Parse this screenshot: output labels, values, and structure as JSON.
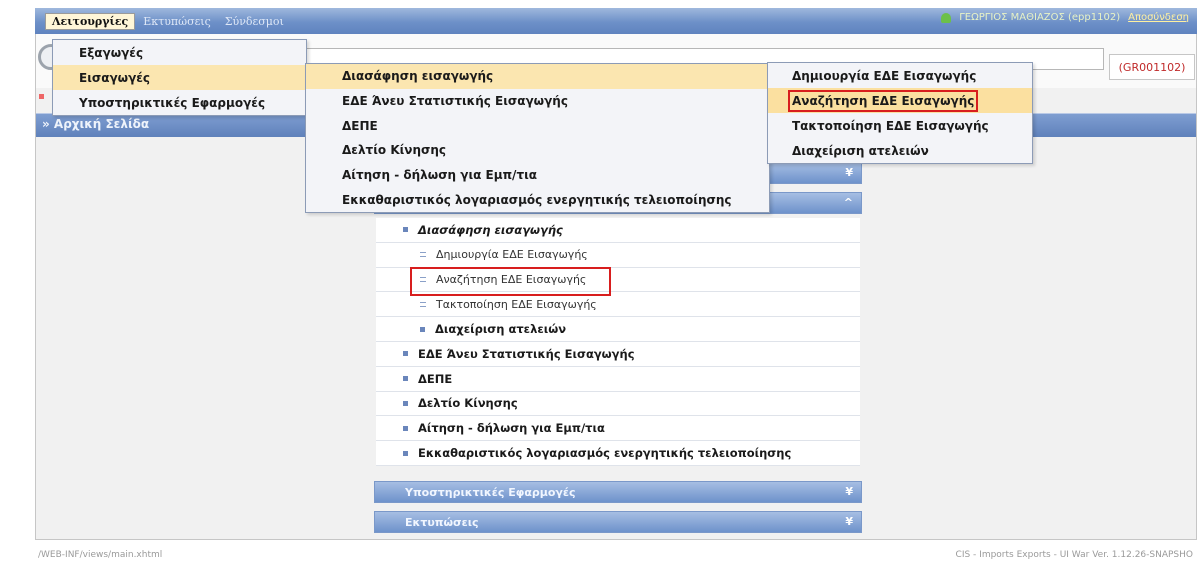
{
  "topmenu": {
    "items": [
      "Λειτουργίες",
      "Εκτυπώσεις",
      "Σύνδεσμοι"
    ]
  },
  "user": {
    "name": "ΓΕΩΡΓΙΟΣ ΜΑΘΙΑΖΟΣ (epp1102)",
    "logout": "Αποσύνδεση"
  },
  "tag": "(GR001102)",
  "home": "» Αρχική Σελίδα",
  "menu1": [
    "Εξαγωγές",
    "Εισαγωγές",
    "Υποστηρικτικές Εφαρμογές"
  ],
  "menu2": [
    "Διασάφηση εισαγωγής",
    "ΕΔΕ Άνευ Στατιστικής Εισαγωγής",
    "ΔΕΠΕ",
    "Δελτίο Κίνησης",
    "Αίτηση - δήλωση για Εμπ/τια",
    "Εκκαθαριστικός λογαριασμός ενεργητικής τελειοποίησης"
  ],
  "menu3": [
    "Δημιουργία ΕΔΕ Εισαγωγής",
    "Αναζήτηση ΕΔΕ Εισαγωγής",
    "Τακτοποίηση ΕΔΕ Εισαγωγής",
    "Διαχείριση ατελειών"
  ],
  "panel": {
    "rows": [
      "Διασάφηση εισαγωγής",
      "Δημιουργία ΕΔΕ Εισαγωγής",
      "Αναζήτηση ΕΔΕ Εισαγωγής",
      "Τακτοποίηση ΕΔΕ Εισαγωγής",
      "Διαχείριση ατελειών",
      "ΕΔΕ Άνευ Στατιστικής Εισαγωγής",
      "ΔΕΠΕ",
      "Δελτίο Κίνησης",
      "Αίτηση - δήλωση για Εμπ/τια",
      "Εκκαθαριστικός λογαριασμός ενεργητικής τελειοποίησης"
    ],
    "section_supp": "Υποστηρικτικές Εφαρμογές",
    "section_print": "Εκτυπώσεις"
  },
  "footer": {
    "left": "/WEB-INF/views/main.xhtml",
    "right": "CIS - Imports Exports - UI War Ver. 1.12.26-SNAPSHO"
  },
  "colors": {
    "header": "#6d90c8",
    "highlight": "#d81e1e",
    "menu_selected": "#fbe6b0"
  }
}
